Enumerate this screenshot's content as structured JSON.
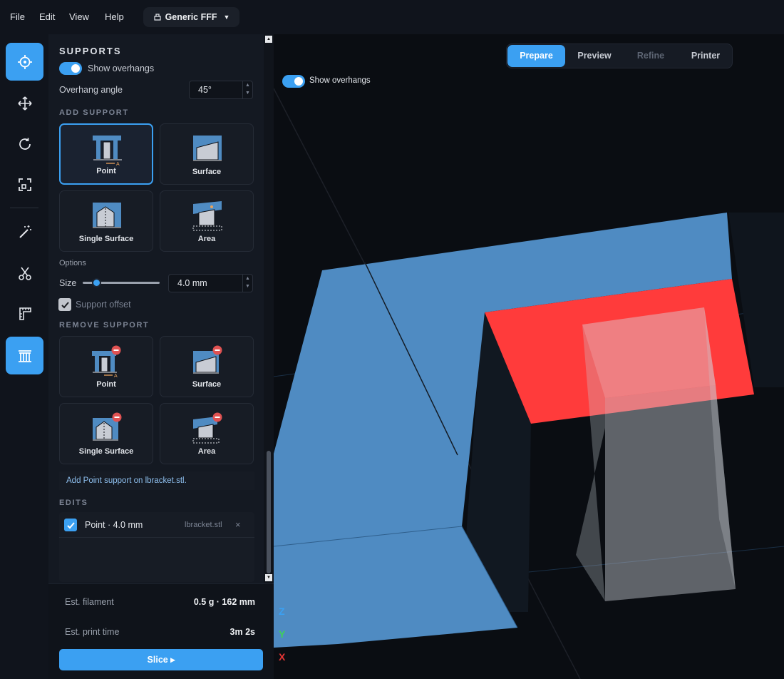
{
  "menu": [
    "File",
    "Edit",
    "View",
    "Help"
  ],
  "printer": {
    "label": "Generic FFF",
    "icon": "printer-icon"
  },
  "tools": [
    {
      "name": "support-target-icon",
      "active": true
    },
    {
      "name": "move-icon",
      "active": false
    },
    {
      "name": "rotate-icon",
      "active": false
    },
    {
      "name": "scale-icon",
      "active": false
    },
    {
      "name": "magic-wand-icon",
      "active": false
    },
    {
      "name": "scissors-icon",
      "active": false
    },
    {
      "name": "ruler-icon",
      "active": false
    },
    {
      "name": "support-structure-icon",
      "active": true
    }
  ],
  "panel": {
    "title": "SUPPORTS",
    "show_overhangs": "Show overhangs",
    "overhang_angle_label": "Overhang angle",
    "overhang_angle_value": "45°",
    "add_support_title": "ADD SUPPORT",
    "add_support": [
      "Point",
      "Surface",
      "Single Surface",
      "Area"
    ],
    "options_label": "Options",
    "size_label": "Size",
    "size_value": "4.0 mm",
    "size_slider": 0.18,
    "support_offset": "Support offset",
    "remove_support_title": "REMOVE SUPPORT",
    "remove_support": [
      "Point",
      "Surface",
      "Single Surface",
      "Area"
    ],
    "status": "Add Point support on lbracket.stl.",
    "edits_title": "EDITS",
    "edits": [
      {
        "name": "Point · 4.0 mm",
        "file": "lbracket.stl",
        "close": "×"
      }
    ]
  },
  "footer": {
    "filament_label": "Est. filament",
    "filament_value": "0.5 g · 162 mm",
    "time_label": "Est. print time",
    "time_value": "3m 2s",
    "slice_label": "Slice ▸"
  },
  "viewport": {
    "tabs": [
      "Prepare",
      "Preview",
      "Refine",
      "Printer"
    ],
    "active_tab": "Prepare",
    "show_overhangs": "Show overhangs",
    "axes": [
      "Z",
      "Y",
      "X"
    ]
  },
  "colors": {
    "accent": "#3ba0f2",
    "model": "#4f8bc2",
    "overhang": "#ff3b3b",
    "axis_z": "#3ba0f2",
    "axis_y": "#3fcf5a",
    "axis_x": "#e53535"
  }
}
